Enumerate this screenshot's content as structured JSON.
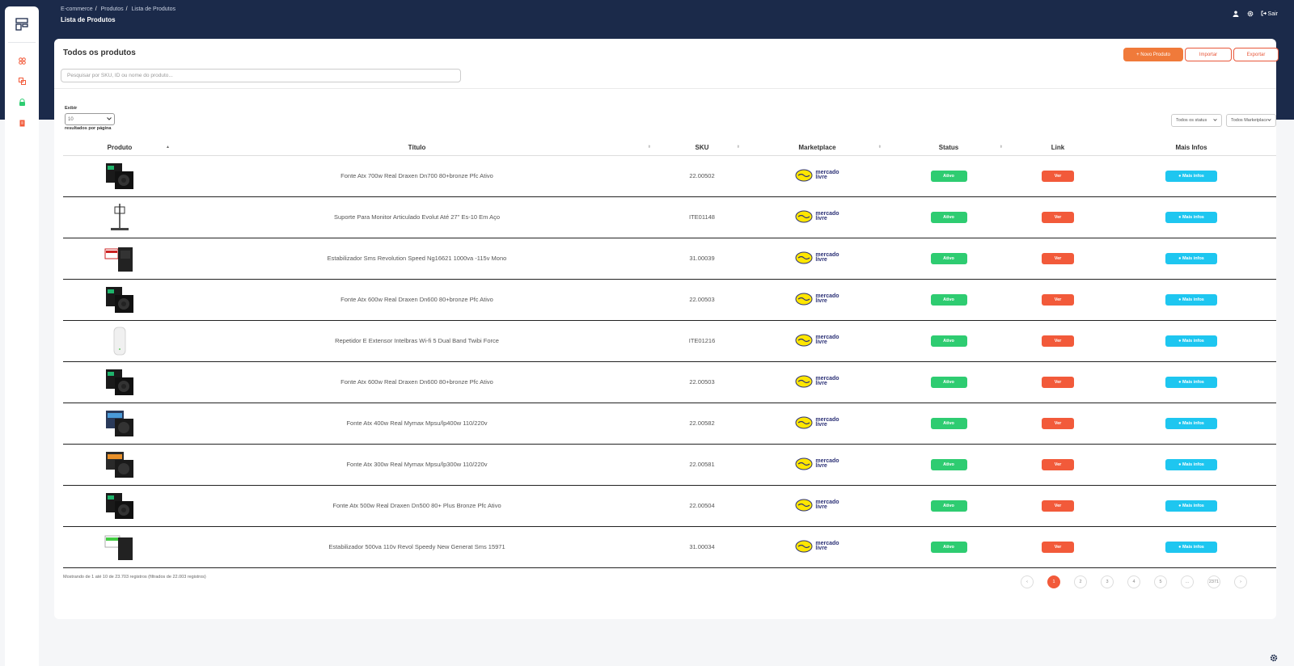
{
  "header": {
    "breadcrumb": [
      "E-commerce",
      "Produtos",
      "Lista de Produtos"
    ],
    "title": "Lista de Produtos",
    "logout_label": "Sair"
  },
  "sidebar": {
    "items": [
      {
        "icon": "grid-icon",
        "color": "#f25a3a"
      },
      {
        "icon": "boxes-icon",
        "color": "#f25a3a"
      },
      {
        "icon": "lock-icon",
        "color": "#2ecc71"
      },
      {
        "icon": "document-icon",
        "color": "#f25a3a"
      }
    ]
  },
  "card": {
    "title": "Todos os produtos",
    "search_placeholder": "Pesquisar por SKU, ID ou nome do produto...",
    "btn_new": "+ Novo Produto",
    "btn_import": "Importar",
    "btn_export": "Exportar",
    "show_label": "Exibir",
    "page_size": "10",
    "per_page_label": "resultados por página",
    "filter_status": "Todos os status",
    "filter_marketplace": "Todos Marketplace"
  },
  "table": {
    "headers": [
      "Produto",
      "Título",
      "SKU",
      "Marketplace",
      "Status",
      "Link",
      "Mais Infos"
    ],
    "rows": [
      {
        "img": "psu-dark",
        "title": "Fonte Atx 700w Real Draxen Dn700 80+bronze Pfc Ativo",
        "sku": "22.00502",
        "status": "Ativo",
        "link": "Ver",
        "info": "Mais infos"
      },
      {
        "img": "monitor-stand",
        "title": "Suporte Para Monitor Articulado Evolut Até 27'' Es-10 Em Aço",
        "sku": "ITE01148",
        "status": "Ativo",
        "link": "Ver",
        "info": "Mais infos"
      },
      {
        "img": "stabilizer-red",
        "title": "Estabilizador Sms Revolution Speed Ng16621 1000va -115v Mono",
        "sku": "31.00039",
        "status": "Ativo",
        "link": "Ver",
        "info": "Mais infos"
      },
      {
        "img": "psu-dark",
        "title": "Fonte Atx 600w Real Draxen Dn600 80+bronze Pfc Ativo",
        "sku": "22.00503",
        "status": "Ativo",
        "link": "Ver",
        "info": "Mais infos"
      },
      {
        "img": "repeater-white",
        "title": "Repetidor E Extensor Intelbras Wi-fi 5 Dual Band Twibi Force",
        "sku": "ITE01216",
        "status": "Ativo",
        "link": "Ver",
        "info": "Mais infos"
      },
      {
        "img": "psu-dark",
        "title": "Fonte Atx 600w Real Draxen Dn600 80+bronze Pfc Ativo",
        "sku": "22.00503",
        "status": "Ativo",
        "link": "Ver",
        "info": "Mais infos"
      },
      {
        "img": "psu-blue",
        "title": "Fonte Atx 400w Real Mymax Mpsu/lp400w 110/220v",
        "sku": "22.00582",
        "status": "Ativo",
        "link": "Ver",
        "info": "Mais infos"
      },
      {
        "img": "psu-orange",
        "title": "Fonte Atx 300w Real Mymax Mpsu/lp300w 110/220v",
        "sku": "22.00581",
        "status": "Ativo",
        "link": "Ver",
        "info": "Mais infos"
      },
      {
        "img": "psu-dark",
        "title": "Fonte Atx 500w Real Draxen Dn500 80+ Plus Bronze Pfc Ativo",
        "sku": "22.00504",
        "status": "Ativo",
        "link": "Ver",
        "info": "Mais infos"
      },
      {
        "img": "stabilizer-green",
        "title": "Estabilizador 500va 110v Revol Speedy New Generat Sms 15971",
        "sku": "31.00034",
        "status": "Ativo",
        "link": "Ver",
        "info": "Mais infos"
      }
    ],
    "marketplace_text": [
      "mercado",
      "livre"
    ]
  },
  "footer": {
    "info": "Mostrando de 1 até 10 de 23.703 registros (filtrados de 22.003 registros)",
    "pages": [
      "1",
      "2",
      "3",
      "4",
      "5",
      "...",
      "2371"
    ],
    "active_page": "1"
  },
  "colors": {
    "header_bg": "#1b2a4a",
    "accent": "#f25a3a",
    "status_green": "#2ecc71",
    "info_cyan": "#1ec6f0"
  }
}
